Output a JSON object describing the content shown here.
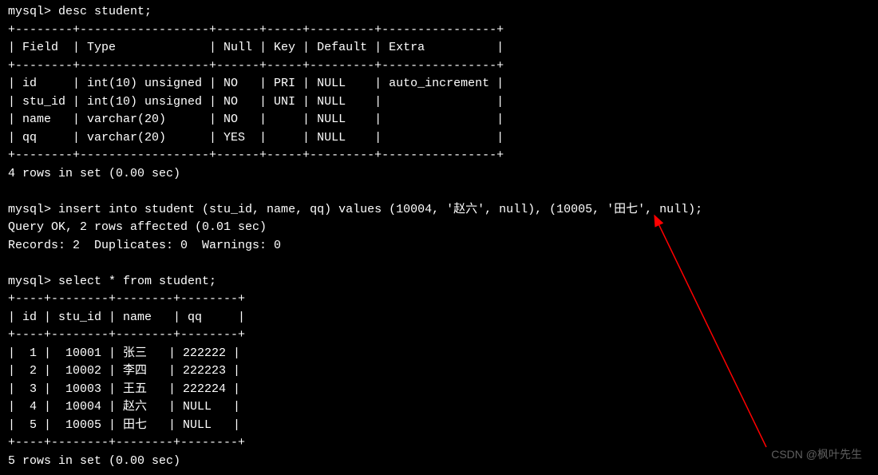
{
  "prompt": "mysql> ",
  "cmd_desc": "desc student;",
  "desc_border": "+--------+------------------+------+-----+---------+----------------+",
  "desc_header": "| Field  | Type             | Null | Key | Default | Extra          |",
  "desc_rows": [
    "| id     | int(10) unsigned | NO   | PRI | NULL    | auto_increment |",
    "| stu_id | int(10) unsigned | NO   | UNI | NULL    |                |",
    "| name   | varchar(20)      | NO   |     | NULL    |                |",
    "| qq     | varchar(20)      | YES  |     | NULL    |                |"
  ],
  "desc_result": "4 rows in set (0.00 sec)",
  "cmd_insert": "insert into student (stu_id, name, qq) values (10004, '赵六', null), (10005, '田七', null);",
  "insert_r1": "Query OK, 2 rows affected (0.01 sec)",
  "insert_r2": "Records: 2  Duplicates: 0  Warnings: 0",
  "cmd_select": "select * from student;",
  "sel_border": "+----+--------+--------+--------+",
  "sel_header": "| id | stu_id | name   | qq     |",
  "sel_rows": [
    "|  1 |  10001 | 张三   | 222222 |",
    "|  2 |  10002 | 李四   | 222223 |",
    "|  3 |  10003 | 王五   | 222224 |",
    "|  4 |  10004 | 赵六   | NULL   |",
    "|  5 |  10005 | 田七   | NULL   |"
  ],
  "sel_result": "5 rows in set (0.00 sec)",
  "watermark": "CSDN @枫叶先生",
  "chart_data": {
    "desc_table": {
      "type": "table",
      "columns": [
        "Field",
        "Type",
        "Null",
        "Key",
        "Default",
        "Extra"
      ],
      "rows": [
        [
          "id",
          "int(10) unsigned",
          "NO",
          "PRI",
          "NULL",
          "auto_increment"
        ],
        [
          "stu_id",
          "int(10) unsigned",
          "NO",
          "UNI",
          "NULL",
          ""
        ],
        [
          "name",
          "varchar(20)",
          "NO",
          "",
          "NULL",
          ""
        ],
        [
          "qq",
          "varchar(20)",
          "YES",
          "",
          "NULL",
          ""
        ]
      ]
    },
    "select_table": {
      "type": "table",
      "columns": [
        "id",
        "stu_id",
        "name",
        "qq"
      ],
      "rows": [
        [
          1,
          10001,
          "张三",
          "222222"
        ],
        [
          2,
          10002,
          "李四",
          "222223"
        ],
        [
          3,
          10003,
          "王五",
          "222224"
        ],
        [
          4,
          10004,
          "赵六",
          "NULL"
        ],
        [
          5,
          10005,
          "田七",
          "NULL"
        ]
      ]
    }
  }
}
